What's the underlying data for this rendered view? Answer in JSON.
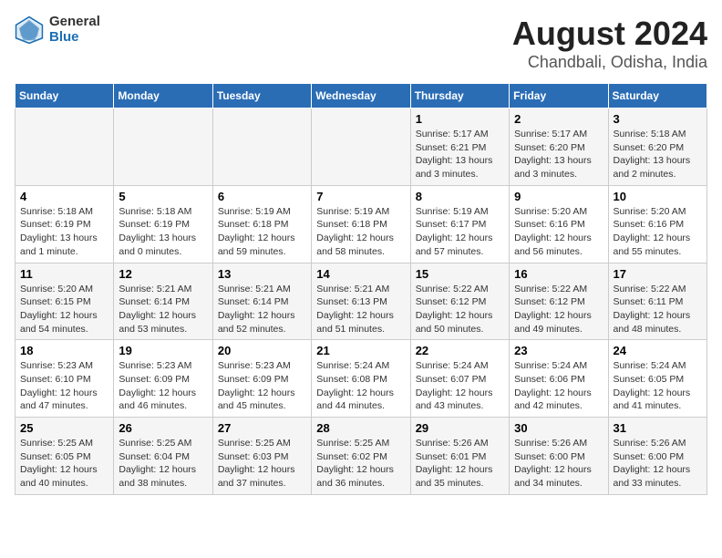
{
  "logo": {
    "general": "General",
    "blue": "Blue"
  },
  "title": "August 2024",
  "subtitle": "Chandbali, Odisha, India",
  "days_of_week": [
    "Sunday",
    "Monday",
    "Tuesday",
    "Wednesday",
    "Thursday",
    "Friday",
    "Saturday"
  ],
  "weeks": [
    [
      {
        "day": "",
        "info": ""
      },
      {
        "day": "",
        "info": ""
      },
      {
        "day": "",
        "info": ""
      },
      {
        "day": "",
        "info": ""
      },
      {
        "day": "1",
        "info": "Sunrise: 5:17 AM\nSunset: 6:21 PM\nDaylight: 13 hours\nand 3 minutes."
      },
      {
        "day": "2",
        "info": "Sunrise: 5:17 AM\nSunset: 6:20 PM\nDaylight: 13 hours\nand 3 minutes."
      },
      {
        "day": "3",
        "info": "Sunrise: 5:18 AM\nSunset: 6:20 PM\nDaylight: 13 hours\nand 2 minutes."
      }
    ],
    [
      {
        "day": "4",
        "info": "Sunrise: 5:18 AM\nSunset: 6:19 PM\nDaylight: 13 hours\nand 1 minute."
      },
      {
        "day": "5",
        "info": "Sunrise: 5:18 AM\nSunset: 6:19 PM\nDaylight: 13 hours\nand 0 minutes."
      },
      {
        "day": "6",
        "info": "Sunrise: 5:19 AM\nSunset: 6:18 PM\nDaylight: 12 hours\nand 59 minutes."
      },
      {
        "day": "7",
        "info": "Sunrise: 5:19 AM\nSunset: 6:18 PM\nDaylight: 12 hours\nand 58 minutes."
      },
      {
        "day": "8",
        "info": "Sunrise: 5:19 AM\nSunset: 6:17 PM\nDaylight: 12 hours\nand 57 minutes."
      },
      {
        "day": "9",
        "info": "Sunrise: 5:20 AM\nSunset: 6:16 PM\nDaylight: 12 hours\nand 56 minutes."
      },
      {
        "day": "10",
        "info": "Sunrise: 5:20 AM\nSunset: 6:16 PM\nDaylight: 12 hours\nand 55 minutes."
      }
    ],
    [
      {
        "day": "11",
        "info": "Sunrise: 5:20 AM\nSunset: 6:15 PM\nDaylight: 12 hours\nand 54 minutes."
      },
      {
        "day": "12",
        "info": "Sunrise: 5:21 AM\nSunset: 6:14 PM\nDaylight: 12 hours\nand 53 minutes."
      },
      {
        "day": "13",
        "info": "Sunrise: 5:21 AM\nSunset: 6:14 PM\nDaylight: 12 hours\nand 52 minutes."
      },
      {
        "day": "14",
        "info": "Sunrise: 5:21 AM\nSunset: 6:13 PM\nDaylight: 12 hours\nand 51 minutes."
      },
      {
        "day": "15",
        "info": "Sunrise: 5:22 AM\nSunset: 6:12 PM\nDaylight: 12 hours\nand 50 minutes."
      },
      {
        "day": "16",
        "info": "Sunrise: 5:22 AM\nSunset: 6:12 PM\nDaylight: 12 hours\nand 49 minutes."
      },
      {
        "day": "17",
        "info": "Sunrise: 5:22 AM\nSunset: 6:11 PM\nDaylight: 12 hours\nand 48 minutes."
      }
    ],
    [
      {
        "day": "18",
        "info": "Sunrise: 5:23 AM\nSunset: 6:10 PM\nDaylight: 12 hours\nand 47 minutes."
      },
      {
        "day": "19",
        "info": "Sunrise: 5:23 AM\nSunset: 6:09 PM\nDaylight: 12 hours\nand 46 minutes."
      },
      {
        "day": "20",
        "info": "Sunrise: 5:23 AM\nSunset: 6:09 PM\nDaylight: 12 hours\nand 45 minutes."
      },
      {
        "day": "21",
        "info": "Sunrise: 5:24 AM\nSunset: 6:08 PM\nDaylight: 12 hours\nand 44 minutes."
      },
      {
        "day": "22",
        "info": "Sunrise: 5:24 AM\nSunset: 6:07 PM\nDaylight: 12 hours\nand 43 minutes."
      },
      {
        "day": "23",
        "info": "Sunrise: 5:24 AM\nSunset: 6:06 PM\nDaylight: 12 hours\nand 42 minutes."
      },
      {
        "day": "24",
        "info": "Sunrise: 5:24 AM\nSunset: 6:05 PM\nDaylight: 12 hours\nand 41 minutes."
      }
    ],
    [
      {
        "day": "25",
        "info": "Sunrise: 5:25 AM\nSunset: 6:05 PM\nDaylight: 12 hours\nand 40 minutes."
      },
      {
        "day": "26",
        "info": "Sunrise: 5:25 AM\nSunset: 6:04 PM\nDaylight: 12 hours\nand 38 minutes."
      },
      {
        "day": "27",
        "info": "Sunrise: 5:25 AM\nSunset: 6:03 PM\nDaylight: 12 hours\nand 37 minutes."
      },
      {
        "day": "28",
        "info": "Sunrise: 5:25 AM\nSunset: 6:02 PM\nDaylight: 12 hours\nand 36 minutes."
      },
      {
        "day": "29",
        "info": "Sunrise: 5:26 AM\nSunset: 6:01 PM\nDaylight: 12 hours\nand 35 minutes."
      },
      {
        "day": "30",
        "info": "Sunrise: 5:26 AM\nSunset: 6:00 PM\nDaylight: 12 hours\nand 34 minutes."
      },
      {
        "day": "31",
        "info": "Sunrise: 5:26 AM\nSunset: 6:00 PM\nDaylight: 12 hours\nand 33 minutes."
      }
    ]
  ]
}
